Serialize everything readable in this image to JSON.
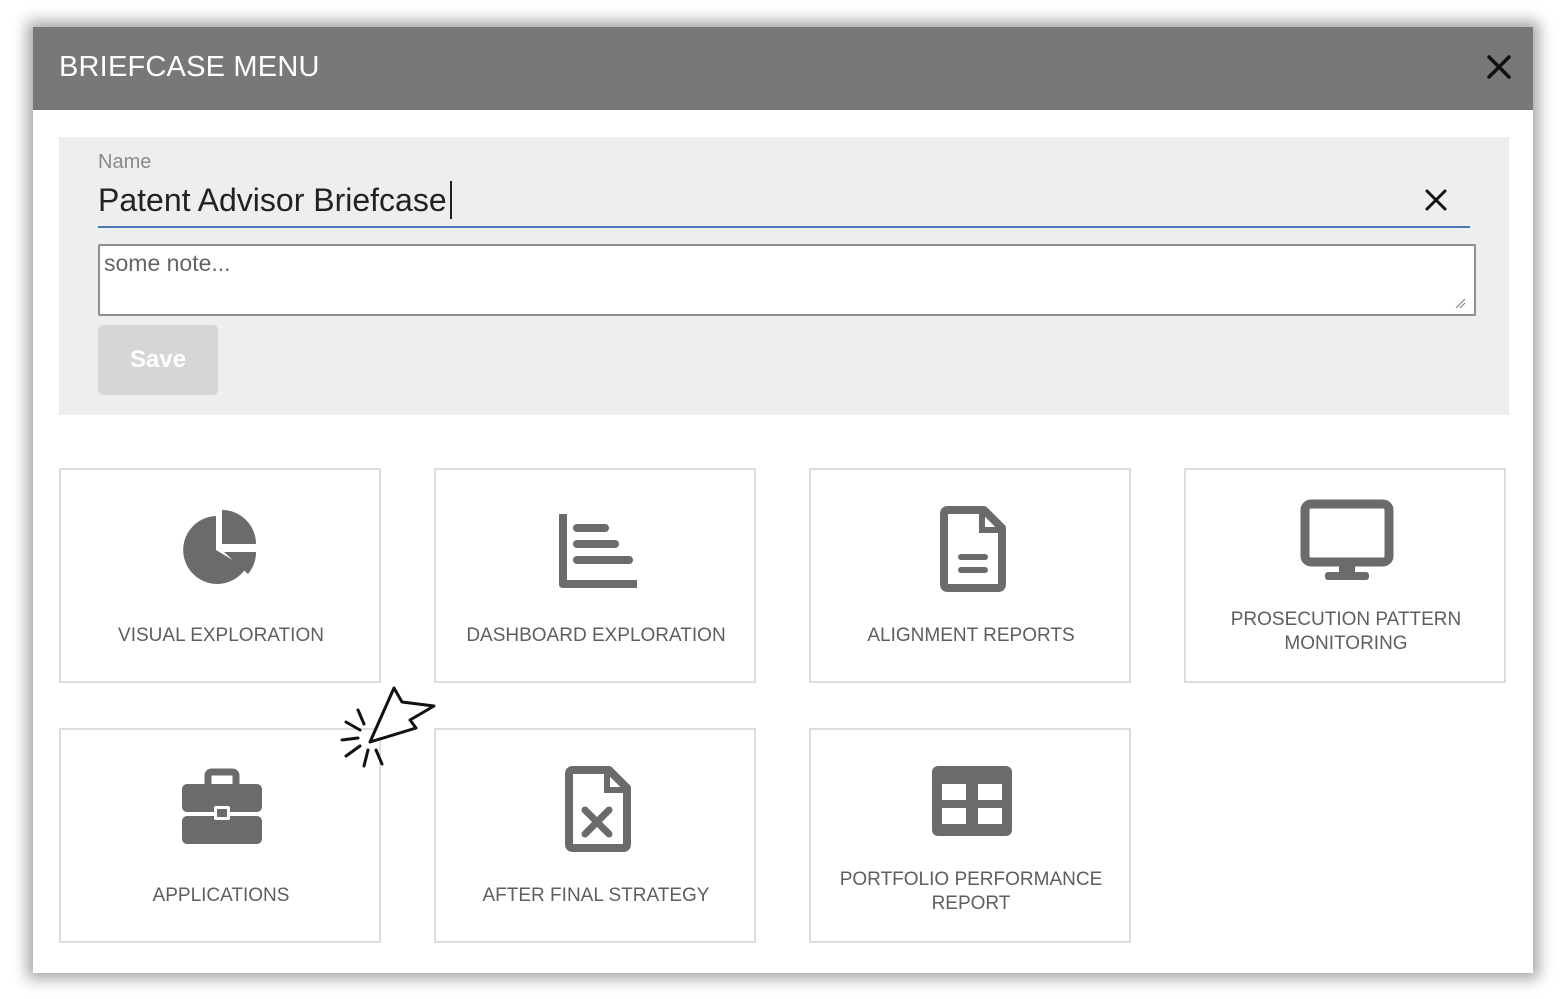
{
  "modal": {
    "title": "BRIEFCASE MENU"
  },
  "form": {
    "name_label": "Name",
    "name_value": "Patent Advisor Briefcase",
    "note_placeholder": "some note...",
    "save_label": "Save"
  },
  "tiles": [
    {
      "label": "VISUAL EXPLORATION",
      "icon": "pie-chart-icon"
    },
    {
      "label": "DASHBOARD EXPLORATION",
      "icon": "bar-chart-icon"
    },
    {
      "label": "ALIGNMENT REPORTS",
      "icon": "document-icon"
    },
    {
      "label": "PROSECUTION PATTERN MONITORING",
      "icon": "monitor-icon"
    },
    {
      "label": "APPLICATIONS",
      "icon": "briefcase-icon"
    },
    {
      "label": "AFTER FINAL STRATEGY",
      "icon": "excel-file-icon"
    },
    {
      "label": "PORTFOLIO PERFORMANCE REPORT",
      "icon": "table-icon"
    }
  ],
  "colors": {
    "header_bg": "#787878",
    "panel_bg": "#eeeeee",
    "icon_gray": "#6b6b6b",
    "label_gray": "#5e5e5e",
    "underline_blue": "#4a78b8"
  }
}
